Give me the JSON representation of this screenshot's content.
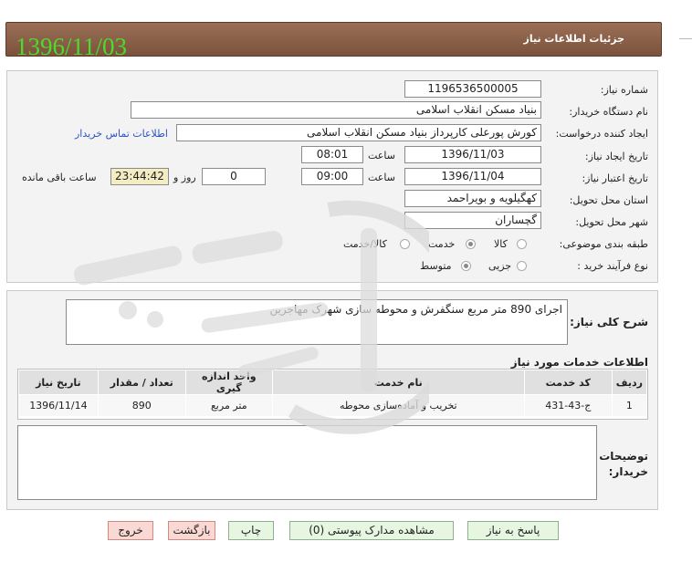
{
  "header": {
    "title": "جزئیات اطلاعات نیاز",
    "date_stamp": "1396/11/03"
  },
  "form": {
    "need_number": {
      "label": "شماره نیاز:",
      "value": "1196536500005"
    },
    "buyer_org": {
      "label": "نام دستگاه خریدار:",
      "value": "بنیاد مسکن انقلاب اسلامی"
    },
    "requester": {
      "label": "ایجاد کننده درخواست:",
      "value": "کورش پورعلی کارپرداز بنیاد مسکن انقلاب اسلامی",
      "contact_link": "اطلاعات تماس خریدار"
    },
    "created": {
      "label": "تاریخ ایجاد نیاز:",
      "date": "1396/11/03",
      "time_label": "ساعت",
      "time": "08:01"
    },
    "validity": {
      "label": "تاریخ اعتبار نیاز:",
      "date": "1396/11/04",
      "time_label": "ساعت",
      "time": "09:00",
      "days": "0",
      "days_label": "روز و",
      "remaining": "23:44:42",
      "remaining_label": "ساعت باقی مانده"
    },
    "province": {
      "label": "استان محل تحویل:",
      "value": "کهگیلویه و بویراحمد"
    },
    "city": {
      "label": "شهر محل تحویل:",
      "value": "گچساران"
    },
    "category": {
      "label": "طبقه بندی موضوعی:",
      "options": [
        "کالا",
        "خدمت",
        "کالا/خدمت"
      ],
      "selected": "خدمت"
    },
    "process": {
      "label": "نوع فرآیند خرید :",
      "options": [
        "جزیی",
        "متوسط"
      ],
      "selected": "متوسط"
    }
  },
  "description": {
    "label": "شرح کلی نیاز:",
    "value": "اجرای 890 متر مربع سنگفرش و محوطه سازی شهرک مهاجرین"
  },
  "services": {
    "title": "اطلاعات خدمات مورد نیاز",
    "columns": [
      "ردیف",
      "کد خدمت",
      "نام خدمت",
      "واحد اندازه گیری",
      "تعداد / مقدار",
      "تاریخ نیاز"
    ],
    "rows": [
      [
        "1",
        "ج-43-431",
        "تخریب و آماده‌سازی محوطه",
        "متر مربع",
        "890",
        "1396/11/14"
      ]
    ]
  },
  "buyer_notes": {
    "label_1": "توضیحات",
    "label_2": "خریدار:",
    "value": ""
  },
  "buttons": {
    "reply": "پاسخ به نیاز",
    "attachments": "مشاهده مدارک پیوستی (0)",
    "print": "چاپ",
    "back": "بازگشت",
    "exit": "خروج"
  },
  "colors": {
    "title_bar": "#7b523c",
    "date_stamp": "#4cdb2c",
    "highlight_field": "#f4ecc2",
    "green_button": "#e6f6e0",
    "red_button": "#fad9d4"
  },
  "watermark_icon": "hezareh-gostaran-logo-watermark"
}
